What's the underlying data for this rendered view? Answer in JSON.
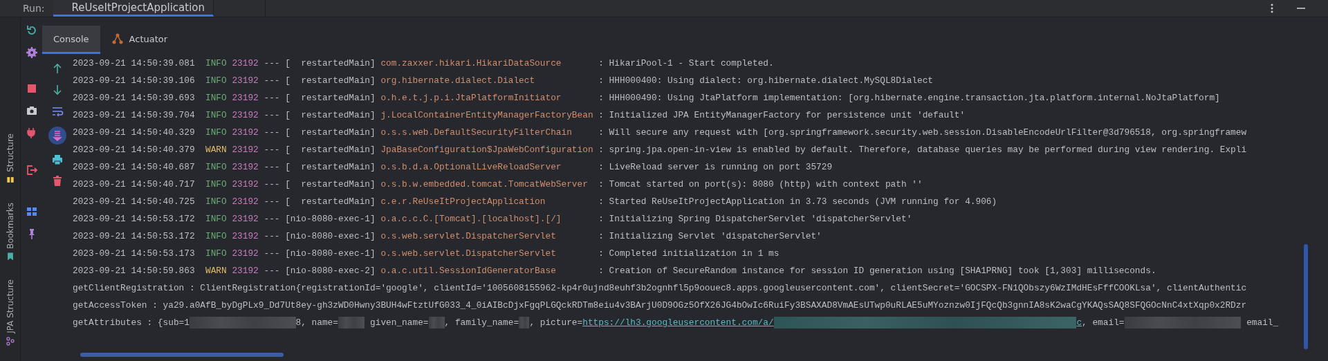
{
  "run_bar": {
    "label": "Run:",
    "tab": {
      "title": "ReUseItProjectApplication",
      "selected": true
    }
  },
  "side_tools": [
    {
      "label": "Structure"
    },
    {
      "label": "Bookmarks"
    },
    {
      "label": "JPA Structure"
    }
  ],
  "console_tabs": [
    {
      "label": "Console",
      "selected": true
    },
    {
      "label": "Actuator",
      "selected": false
    }
  ],
  "lines": [
    {
      "kind": "info",
      "timestamp": "2023-09-21 14:50:39.081",
      "level": "INFO",
      "pid": "23192",
      "separator": "---",
      "thread": "[  restartedMain]",
      "logger": "com.zaxxer.hikari.HikariDataSource",
      "message": ": HikariPool-1 - Start completed."
    },
    {
      "kind": "info",
      "timestamp": "2023-09-21 14:50:39.106",
      "level": "INFO",
      "pid": "23192",
      "separator": "---",
      "thread": "[  restartedMain]",
      "logger": "org.hibernate.dialect.Dialect",
      "message": ": HHH000400: Using dialect: org.hibernate.dialect.MySQL8Dialect"
    },
    {
      "kind": "info",
      "timestamp": "2023-09-21 14:50:39.693",
      "level": "INFO",
      "pid": "23192",
      "separator": "---",
      "thread": "[  restartedMain]",
      "logger": "o.h.e.t.j.p.i.JtaPlatformInitiator",
      "message": ": HHH000490: Using JtaPlatform implementation: [org.hibernate.engine.transaction.jta.platform.internal.NoJtaPlatform]"
    },
    {
      "kind": "info",
      "timestamp": "2023-09-21 14:50:39.704",
      "level": "INFO",
      "pid": "23192",
      "separator": "---",
      "thread": "[  restartedMain]",
      "logger": "j.LocalContainerEntityManagerFactoryBean",
      "message": ": Initialized JPA EntityManagerFactory for persistence unit 'default'"
    },
    {
      "kind": "info",
      "timestamp": "2023-09-21 14:50:40.329",
      "level": "INFO",
      "pid": "23192",
      "separator": "---",
      "thread": "[  restartedMain]",
      "logger": "o.s.s.web.DefaultSecurityFilterChain",
      "message": ": Will secure any request with [org.springframework.security.web.session.DisableEncodeUrlFilter@3d796518, org.springframew"
    },
    {
      "kind": "warn",
      "timestamp": "2023-09-21 14:50:40.379",
      "level": "WARN",
      "pid": "23192",
      "separator": "---",
      "thread": "[  restartedMain]",
      "logger": "JpaBaseConfiguration$JpaWebConfiguration",
      "message": ": spring.jpa.open-in-view is enabled by default. Therefore, database queries may be performed during view rendering. Expli"
    },
    {
      "kind": "info",
      "timestamp": "2023-09-21 14:50:40.687",
      "level": "INFO",
      "pid": "23192",
      "separator": "---",
      "thread": "[  restartedMain]",
      "logger": "o.s.b.d.a.OptionalLiveReloadServer",
      "message": ": LiveReload server is running on port 35729"
    },
    {
      "kind": "info",
      "timestamp": "2023-09-21 14:50:40.717",
      "level": "INFO",
      "pid": "23192",
      "separator": "---",
      "thread": "[  restartedMain]",
      "logger": "o.s.b.w.embedded.tomcat.TomcatWebServer",
      "message": ": Tomcat started on port(s): 8080 (http) with context path ''"
    },
    {
      "kind": "info",
      "timestamp": "2023-09-21 14:50:40.725",
      "level": "INFO",
      "pid": "23192",
      "separator": "---",
      "thread": "[  restartedMain]",
      "logger": "c.e.r.ReUseItProjectApplication",
      "message": ": Started ReUseItProjectApplication in 3.73 seconds (JVM running for 4.906)"
    },
    {
      "kind": "info",
      "timestamp": "2023-09-21 14:50:53.172",
      "level": "INFO",
      "pid": "23192",
      "separator": "---",
      "thread": "[nio-8080-exec-1]",
      "logger": "o.a.c.c.C.[Tomcat].[localhost].[/]",
      "message": ": Initializing Spring DispatcherServlet 'dispatcherServlet'"
    },
    {
      "kind": "info",
      "timestamp": "2023-09-21 14:50:53.172",
      "level": "INFO",
      "pid": "23192",
      "separator": "---",
      "thread": "[nio-8080-exec-1]",
      "logger": "o.s.web.servlet.DispatcherServlet",
      "message": ": Initializing Servlet 'dispatcherServlet'"
    },
    {
      "kind": "info",
      "timestamp": "2023-09-21 14:50:53.173",
      "level": "INFO",
      "pid": "23192",
      "separator": "---",
      "thread": "[nio-8080-exec-1]",
      "logger": "o.s.web.servlet.DispatcherServlet",
      "message": ": Completed initialization in 1 ms"
    },
    {
      "kind": "warn",
      "timestamp": "2023-09-21 14:50:59.863",
      "level": "WARN",
      "pid": "23192",
      "separator": "---",
      "thread": "[nio-8080-exec-2]",
      "logger": "o.a.c.util.SessionIdGeneratorBase",
      "message": ": Creation of SecureRandom instance for session ID generation using [SHA1PRNG] took [1,303] milliseconds."
    },
    {
      "kind": "plain",
      "segments": [
        {
          "kind": "text",
          "text": "getClientRegistration : ClientRegistration{registrationId='google', clientId='1005608155962-kp4r0ujnd8euhf3b2ognhfl5p9oouec8.apps.googleusercontent.com', clientSecret='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', clientAuthentic"
        }
      ]
    },
    {
      "kind": "plain",
      "segments": [
        {
          "kind": "text",
          "text": "getAccessToken : ya29.a0AfB_byDgPLx9_Dd7Ut8ey-gh3zWD0Hwny3BUH4wFtztUfG033_4_0iAIBcDjxFgqPLGQckRDTm8eiu4v3BArjU0D9OGz5OfX26JG4bOwIc6RuiFy3BSAXAD8VmAEsUTwp0uRLAE5uMYoznzw0IjFQcQb3gnnIA8sK2waCgYKAQsSAQ8SFQGOcNnC4xtXqp0x2RDzr"
        }
      ]
    },
    {
      "kind": "plain",
      "segments": [
        {
          "kind": "text",
          "text": "getAttributes : {sub=1"
        },
        {
          "kind": "redacted"
        },
        {
          "kind": "text",
          "text": "8, name="
        },
        {
          "kind": "redacted"
        },
        {
          "kind": "text",
          "text": " given_name="
        },
        {
          "kind": "redacted"
        },
        {
          "kind": "text",
          "text": ", family_name="
        },
        {
          "kind": "redacted"
        },
        {
          "kind": "text",
          "text": ", picture="
        },
        {
          "kind": "link",
          "text": "https://lh3.googleusercontent.com/a/"
        },
        {
          "kind": "redacted_link"
        },
        {
          "kind": "link",
          "text": "c"
        },
        {
          "kind": "text",
          "text": ", email="
        },
        {
          "kind": "redacted"
        },
        {
          "kind": "text",
          "text": " email_"
        }
      ]
    }
  ]
}
